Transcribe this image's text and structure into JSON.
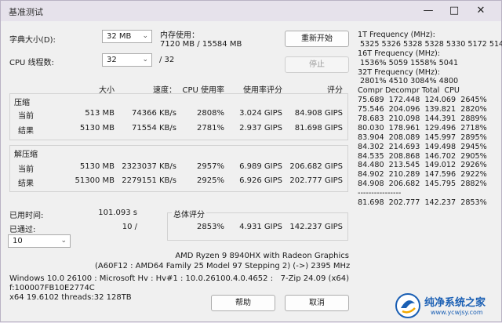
{
  "window": {
    "title": "基准测试"
  },
  "controls": {
    "dict_label": "字典大小(D):",
    "dict_value": "32 MB",
    "threads_label": "CPU 线程数:",
    "threads_value": "32",
    "threads_total": "/ 32",
    "mem_label": "内存使用：",
    "mem_value": "7120 MB / 15584 MB",
    "restart_button": "重新开始",
    "stop_button": "停止"
  },
  "table": {
    "headers": {
      "size": "大小",
      "speed": "速度：",
      "cpu": "CPU 使用率",
      "rating_usage": "使用率评分",
      "rating": "评分"
    },
    "compress": {
      "label": "压缩",
      "rows": [
        {
          "name": "当前",
          "size": "513 MB",
          "speed": "74366 KB/s",
          "cpu": "2808%",
          "rating_usage": "3.024 GIPS",
          "rating": "84.908 GIPS"
        },
        {
          "name": "结果",
          "size": "5130 MB",
          "speed": "71554 KB/s",
          "cpu": "2781%",
          "rating_usage": "2.937 GIPS",
          "rating": "81.698 GIPS"
        }
      ]
    },
    "decompress": {
      "label": "解压缩",
      "rows": [
        {
          "name": "当前",
          "size": "5130 MB",
          "speed": "2323037 KB/s",
          "cpu": "2957%",
          "rating_usage": "6.989 GIPS",
          "rating": "206.682 GIPS"
        },
        {
          "name": "结果",
          "size": "51300 MB",
          "speed": "2279151 KB/s",
          "cpu": "2925%",
          "rating_usage": "6.926 GIPS",
          "rating": "202.777 GIPS"
        }
      ]
    }
  },
  "stats": {
    "elapsed_label": "已用时间:",
    "elapsed_value": "101.093 s",
    "passed_label": "已通过:",
    "passed_value": "10 /",
    "passes_select": "10"
  },
  "total": {
    "label": "总体评分",
    "cpu": "2853%",
    "rating_usage": "4.931 GIPS",
    "rating": "142.237 GIPS"
  },
  "system": {
    "cpu_line1": "AMD Ryzen 9 8940HX with Radeon Graphics",
    "cpu_line2": "(A60F12 : AMD64 Family 25 Model 97 Stepping 2) (->) 2395 MHz",
    "os_line": "Windows 10.0 26100 : Microsoft Hv : Hv#1 : 10.0.26100.4.0.4652 :",
    "flags_line": "f:100007FB10E2774C",
    "arch_line": "x64 19.6102 threads:32 128TB",
    "version": "7-Zip 24.09 (x64)",
    "help_button": "帮助",
    "cancel_button": "取消"
  },
  "log": [
    "1T Frequency (MHz):",
    " 5325 5326 5328 5328 5330 5172 5142",
    "16T Frequency (MHz):",
    " 1536% 5059 1558% 5041",
    "32T Frequency (MHz):",
    " 2801% 4510 3084% 4800",
    "Compr Decompr Total  CPU",
    "75.689  172.448  124.069  2645%",
    "75.546  204.096  139.821  2820%",
    "78.683  210.098  144.391  2889%",
    "80.030  178.961  129.496  2718%",
    "83.904  208.089  145.997  2895%",
    "84.302  214.693  149.498  2945%",
    "84.535  208.868  146.702  2905%",
    "84.480  213.545  149.012  2926%",
    "84.902  210.289  147.596  2922%",
    "84.908  206.682  145.795  2882%",
    "----------------",
    "81.698  202.777  142.237  2853%"
  ],
  "watermark": {
    "brand": "纯净系统之家",
    "url": "www.ycwjsy.com"
  },
  "colors": {
    "titlebar": "#e6e2eb",
    "window": "#f0f0f0",
    "brand_blue": "#1a5fb4"
  }
}
